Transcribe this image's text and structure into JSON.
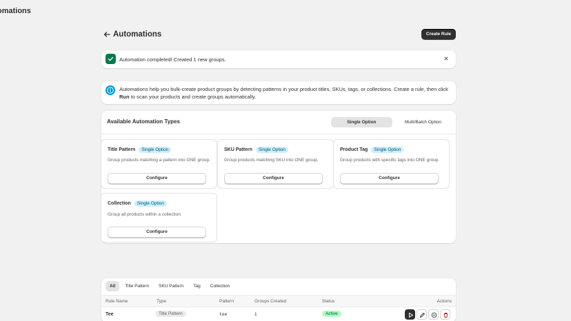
{
  "app": {
    "title": "omations"
  },
  "header": {
    "title": "Automations",
    "create_label": "Create Rule"
  },
  "success_banner": {
    "message": "Automation completed! Created 1 new groups."
  },
  "info_banner": {
    "part1": "Automations help you bulk-create product groups by detecting patterns in your product titles, SKUs, tags, or collections. Create a rule, then click ",
    "bold": "Run",
    "part2": " to scan your products and create groups automatically."
  },
  "types": {
    "title": "Available Automation Types",
    "segments": [
      "Single Option",
      "Multi/Batch Option"
    ],
    "configure_label": "Configure",
    "items": [
      {
        "name": "Title Pattern",
        "badge": "Single Option",
        "desc": "Group products matching a pattern into ONE group."
      },
      {
        "name": "SKU Pattern",
        "badge": "Single Option",
        "desc": "Group products matching SKU into ONE group."
      },
      {
        "name": "Product Tag",
        "badge": "Single Option",
        "desc": "Group products with specific tags into ONE group."
      },
      {
        "name": "Collection",
        "badge": "Single Option",
        "desc": "Group all products within a collection."
      }
    ]
  },
  "rules": {
    "tabs": [
      "All",
      "Title Pattern",
      "SKU Pattern",
      "Tag",
      "Collection"
    ],
    "columns": [
      "Rule Name",
      "Type",
      "Pattern",
      "Groups Created",
      "Status",
      "Actions"
    ],
    "rows": [
      {
        "name": "Tee",
        "type": "Title Pattern",
        "pattern": "tee",
        "groups": "1",
        "status": "Active"
      }
    ]
  },
  "colors": {
    "primary": "#303030",
    "success": "#067a4c",
    "info": "#0094d5",
    "badge_info_bg": "#cdeefc",
    "status_active_bg": "#affebf",
    "delete": "#c70a24"
  }
}
